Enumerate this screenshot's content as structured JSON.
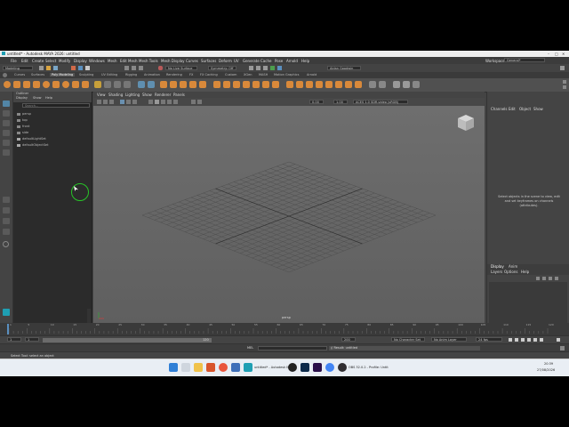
{
  "window": {
    "title": "untitled* - Autodesk MAYA 2026: untitled"
  },
  "menubar": [
    "File",
    "Edit",
    "Create",
    "Select",
    "Modify",
    "Display",
    "Windows",
    "Mesh",
    "Edit Mesh",
    "Mesh Tools",
    "Mesh Display",
    "Curves",
    "Surfaces",
    "Deform",
    "UV",
    "Generate",
    "Cache",
    "Pose",
    "Arnold",
    "Help"
  ],
  "workspace": {
    "label": "Workspace:",
    "value": "General*"
  },
  "statusline": {
    "mode": "Modeling",
    "live_surface": "No Live Surface",
    "symmetry": "Symmetry: Off",
    "user": "Aidan Goodwin"
  },
  "shelf_tabs": [
    "Curves",
    "Surfaces",
    "Poly Modeling",
    "Sculpting",
    "UV Editing",
    "Rigging",
    "Animation",
    "Rendering",
    "FX",
    "FX Caching",
    "Custom",
    "XGen",
    "MASH",
    "Motion Graphics",
    "Arnold"
  ],
  "shelf_active": "Poly Modeling",
  "outliner": {
    "title": "Outliner",
    "menu": [
      "Display",
      "Show",
      "Help"
    ],
    "search_placeholder": "Search...",
    "items": [
      "persp",
      "top",
      "front",
      "side",
      "defaultLightSet",
      "defaultObjectSet"
    ]
  },
  "viewport": {
    "menu": [
      "View",
      "Shading",
      "Lighting",
      "Show",
      "Renderer",
      "Panels"
    ],
    "field1": "0.00",
    "field2": "1.00",
    "colorspace": "ACES 1.0 SDR-video (sRGB)",
    "camera_label": "persp"
  },
  "channelbox": {
    "menu": [
      "Channels",
      "Edit",
      "Object",
      "Show"
    ],
    "empty_text": "Select objects in the scene to view, edit and set keyframes on channels (attributes).",
    "layer_tabs": [
      "Display",
      "Anim"
    ],
    "layer_menu": [
      "Layers",
      "Options",
      "Help"
    ]
  },
  "timeline": {
    "ticks": [
      "1",
      "5",
      "10",
      "15",
      "20",
      "25",
      "30",
      "35",
      "40",
      "45",
      "50",
      "55",
      "60",
      "65",
      "70",
      "75",
      "80",
      "85",
      "90",
      "95",
      "100",
      "105",
      "110",
      "115",
      "120"
    ],
    "current": "1"
  },
  "range": {
    "start": "1",
    "inner_start": "1",
    "inner_end": "120",
    "end": "200",
    "char_set": "No Character Set",
    "anim_layer": "No Anim Layer",
    "fps": "24 fps"
  },
  "mel": {
    "label": "MEL",
    "result": "// Result: untitled"
  },
  "helpline": "Select Tool: select an object",
  "taskbar": {
    "maya_label": "untitled* - Autodesk MA",
    "obs_label": "OBS 32.0.2 - Profile: Untit",
    "time": "20:39",
    "date": "27/08/2026"
  },
  "colors": {
    "accent": "#5285a6",
    "cursor_ring": "#27c427"
  }
}
